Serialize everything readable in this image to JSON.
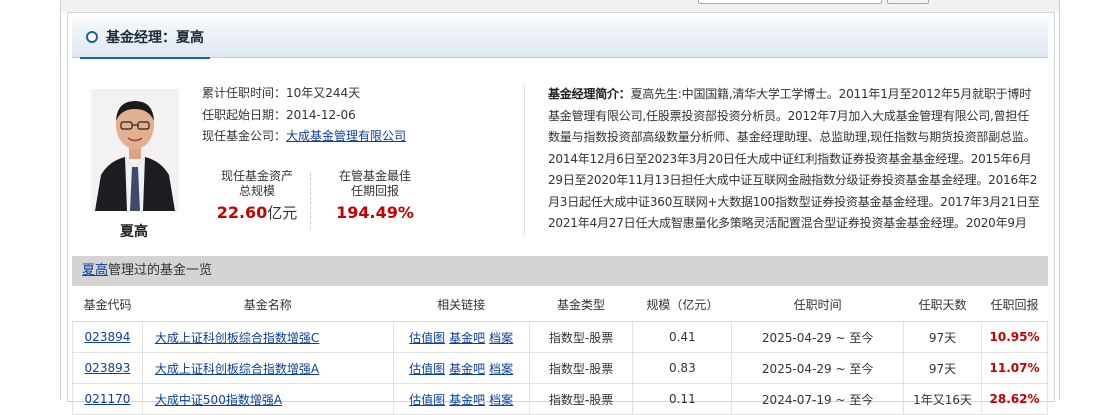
{
  "header": {
    "title": "基金经理：夏高"
  },
  "manager": {
    "name": "夏高",
    "tenure_label": "累计任职时间：",
    "tenure_value": "10年又244天",
    "start_label": "任职起始日期：",
    "start_value": "2014-12-06",
    "company_label": "现任基金公司：",
    "company_value": "大成基金管理有限公司"
  },
  "stats": {
    "aum_label_1": "现任基金资产",
    "aum_label_2": "总规模",
    "aum_value": "22.60",
    "aum_unit": "亿元",
    "best_label_1": "在管基金最佳",
    "best_label_2": "任期回报",
    "best_value": "194.49%"
  },
  "bio": {
    "label": "基金经理简介：",
    "text": "夏高先生:中国国籍,清华大学工学博士。2011年1月至2012年5月就职于博时基金管理有限公司,任股票投资部投资分析员。2012年7月加入大成基金管理有限公司,曾担任数量与指数投资部高级数量分析师、基金经理助理、总监助理,现任指数与期货投资部副总监。2014年12月6日至2023年3月20日任大成中证红利指数证券投资基金基金经理。2015年6月29日至2020年11月13日担任大成中证互联网金融指数分级证券投资基金基金经理。2016年2月3日起任大成中证360互联网+大数据100指数型证券投资基金基金经理。2017年3月21日至2021年4月27日任大成智惠量化多策略灵活配置混合型证券投资基金基金经理。2020年9月"
  },
  "funds_section": {
    "manager_link": "夏高",
    "title_suffix": "管理过的基金一览"
  },
  "table": {
    "headers": [
      "基金代码",
      "基金名称",
      "相关链接",
      "基金类型",
      "规模（亿元）",
      "任职时间",
      "任职天数",
      "任职回报"
    ],
    "link_labels": [
      "估值图",
      "基金吧",
      "档案"
    ],
    "rows": [
      {
        "code": "023894",
        "name": "大成上证科创板综合指数增强C",
        "type": "指数型-股票",
        "size": "0.41",
        "period": "2025-04-29 ~ 至今",
        "days": "97天",
        "ret": "10.95%"
      },
      {
        "code": "023893",
        "name": "大成上证科创板综合指数增强A",
        "type": "指数型-股票",
        "size": "0.83",
        "period": "2025-04-29 ~ 至今",
        "days": "97天",
        "ret": "11.07%"
      },
      {
        "code": "021170",
        "name": "大成中证500指数增强A",
        "type": "指数型-股票",
        "size": "0.11",
        "period": "2024-07-19 ~ 至今",
        "days": "1年又16天",
        "ret": "28.62%"
      }
    ]
  },
  "colors": {
    "accent": "#1e5ea8",
    "link": "#0b3fa0",
    "positive": "#c40000"
  },
  "icons": {
    "title": "circle-icon"
  }
}
